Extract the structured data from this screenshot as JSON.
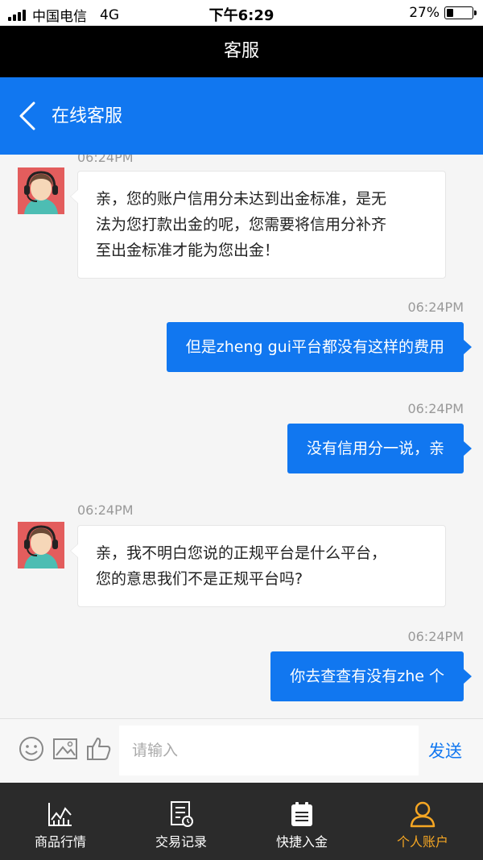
{
  "status_bar": {
    "carrier": "中国电信",
    "network": "4G",
    "time": "下午6:29",
    "battery": "27%",
    "battery_level": 0.27
  },
  "app_title": "客服",
  "header": {
    "title": "在线客服"
  },
  "messages": [
    {
      "side": "in",
      "time": "06:24PM",
      "lines": [
        "亲，您的账户信用分未达到出金标准，是无",
        "法为您打款出金的呢，您需要将信用分补齐",
        "至出金标准才能为您出金！"
      ]
    },
    {
      "side": "out",
      "time": "06:24PM",
      "text": "但是zheng gui平台都没有这样的费用"
    },
    {
      "side": "out",
      "time": "06:24PM",
      "text": "没有信用分一说，亲"
    },
    {
      "side": "in",
      "time": "06:24PM",
      "lines": [
        "亲，我不明白您说的正规平台是什么平台，",
        "您的意思我们不是正规平台吗?"
      ]
    },
    {
      "side": "out",
      "time": "06:24PM",
      "text": "你去查查有没有zhe 个"
    }
  ],
  "input": {
    "placeholder": "请输入",
    "send_label": "发送"
  },
  "tabs": [
    {
      "label": "商品行情",
      "icon": "market-chart-icon",
      "active": false
    },
    {
      "label": "交易记录",
      "icon": "trade-record-icon",
      "active": false
    },
    {
      "label": "快捷入金",
      "icon": "quick-deposit-icon",
      "active": false
    },
    {
      "label": "个人账户",
      "icon": "user-account-icon",
      "active": true
    }
  ],
  "colors": {
    "accent": "#1177f0",
    "tab_active": "#f5a623",
    "tabbar_bg": "#2b2b2b"
  }
}
